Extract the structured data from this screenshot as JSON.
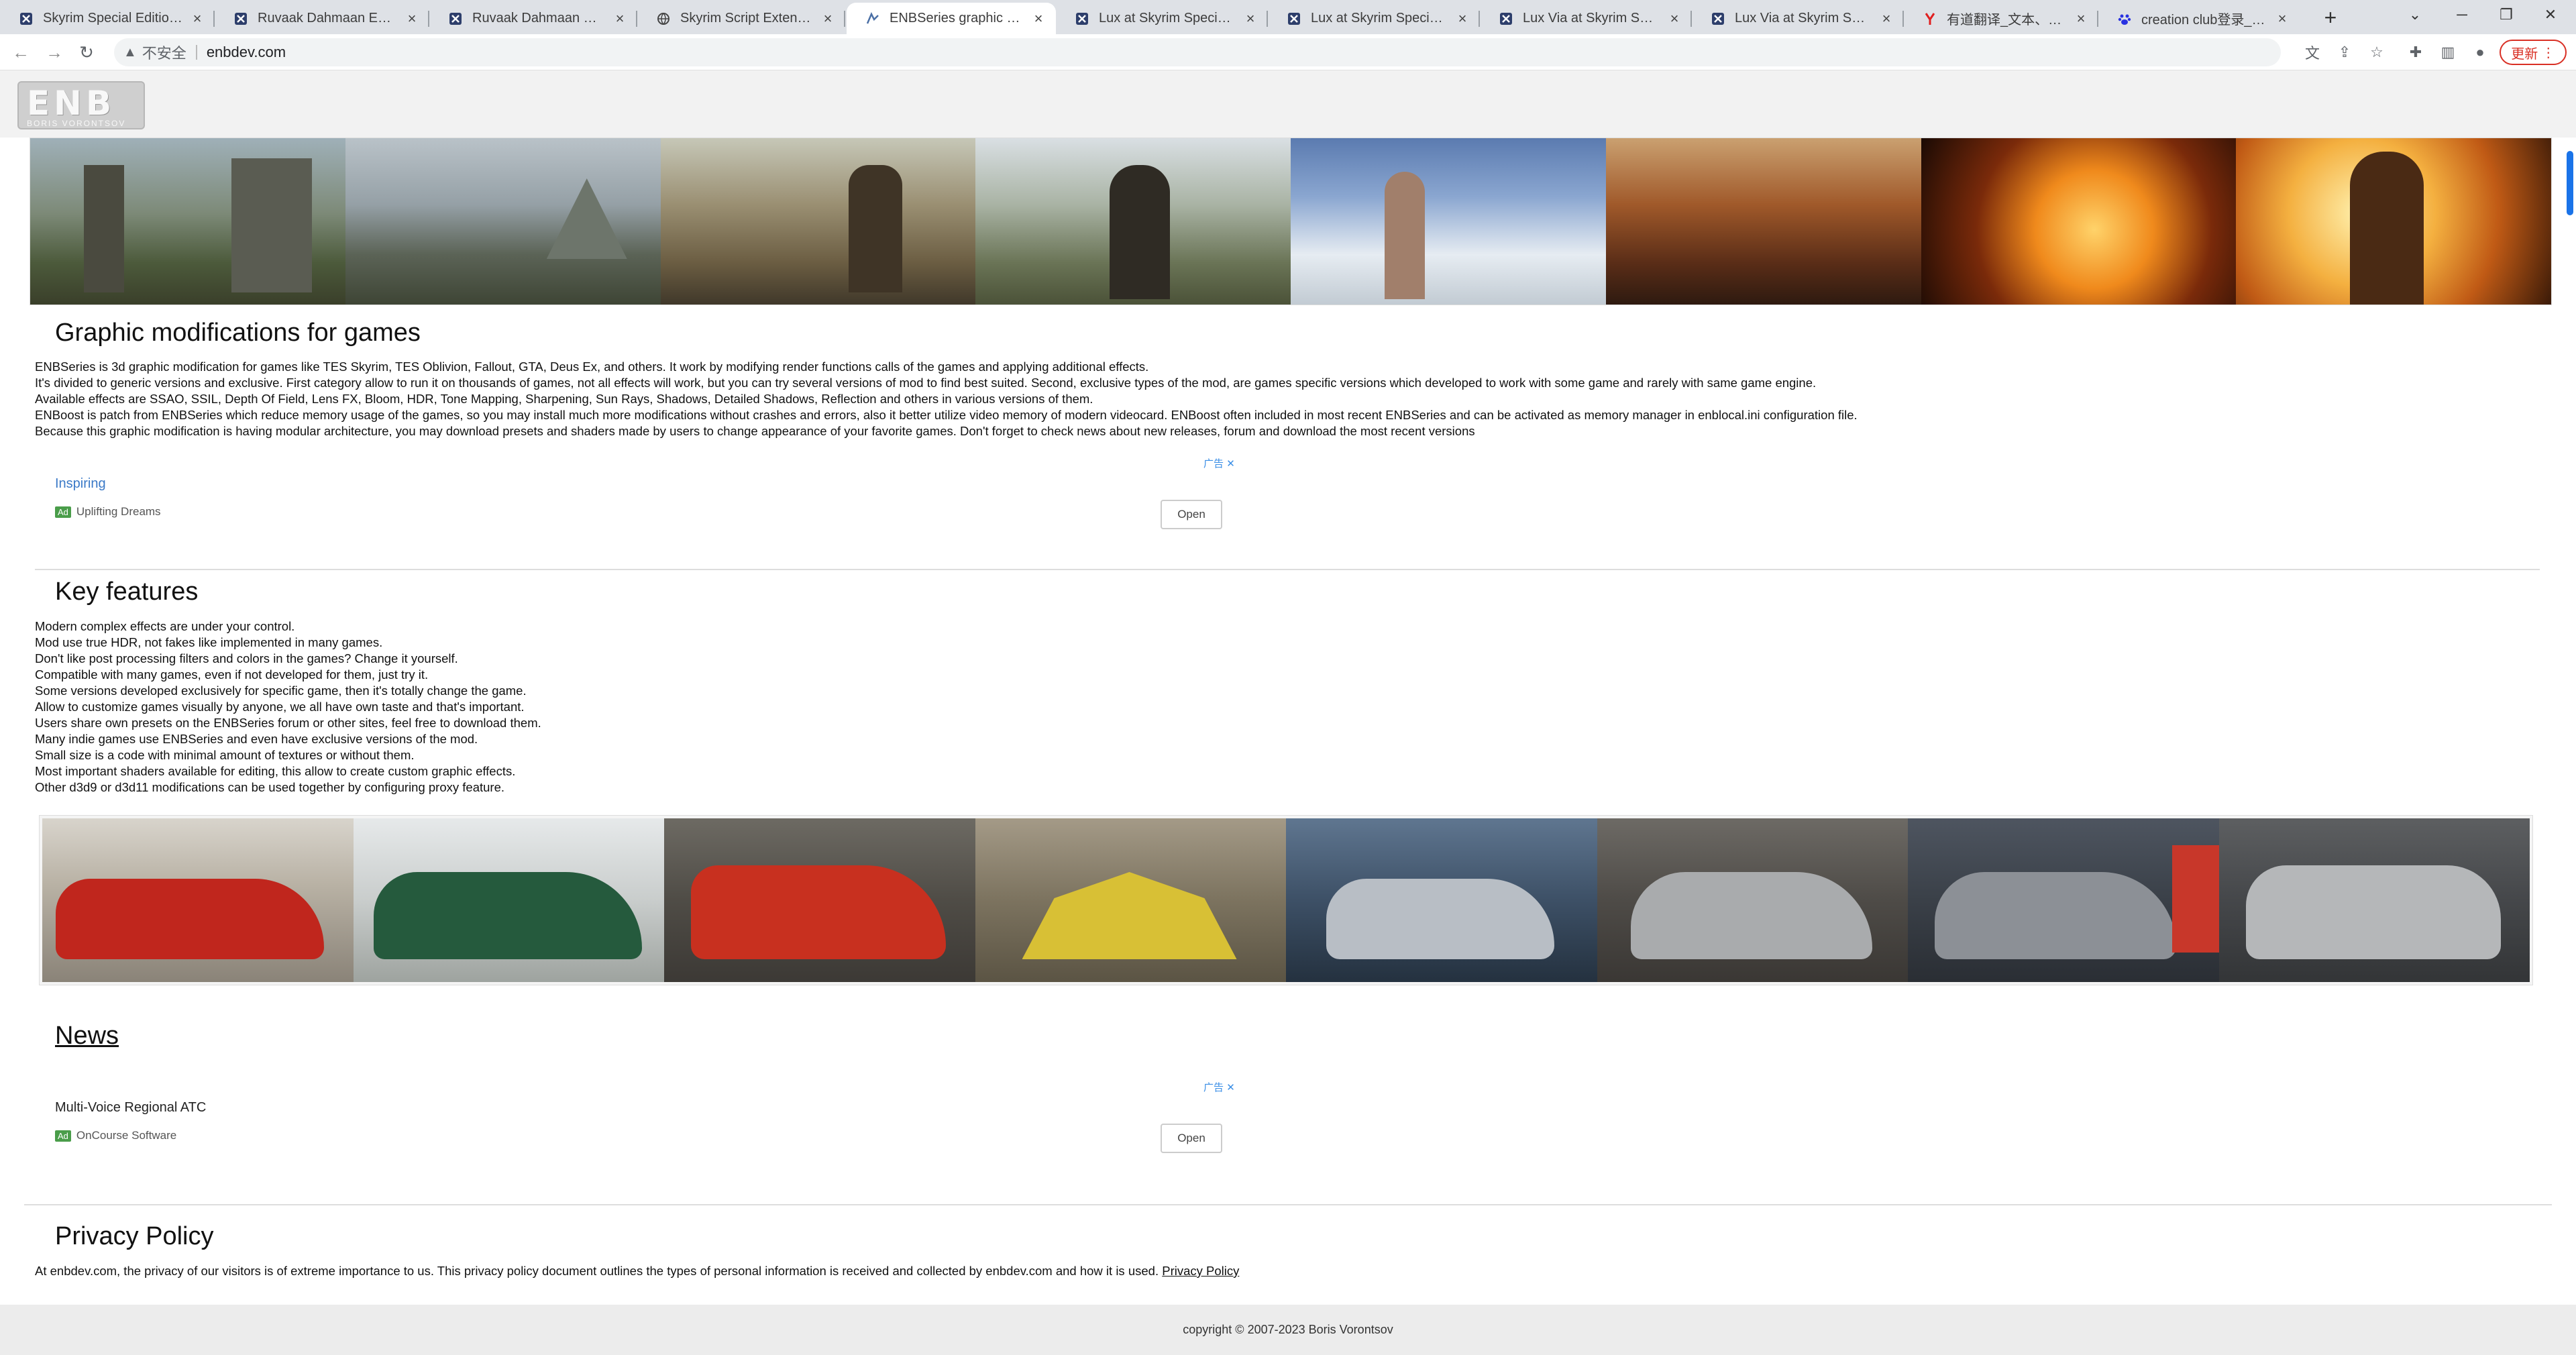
{
  "browser": {
    "tabs": [
      {
        "title": "Skyrim Special Edition Nexus",
        "icon": "nexus-icon",
        "active": false
      },
      {
        "title": "Ruvaak Dahmaan ENB SE",
        "icon": "nexus-icon",
        "active": false
      },
      {
        "title": "Ruvaak Dahmaan ENB SE",
        "icon": "nexus-icon",
        "active": false
      },
      {
        "title": "Skyrim Script Extender (SKSE)",
        "icon": "globe-icon",
        "active": false
      },
      {
        "title": "ENBSeries graphic modification",
        "icon": "enb-icon",
        "active": true
      },
      {
        "title": "Lux at Skyrim Special Edition",
        "icon": "nexus-icon",
        "active": false
      },
      {
        "title": "Lux at Skyrim Special Edition",
        "icon": "nexus-icon",
        "active": false
      },
      {
        "title": "Lux Via at Skyrim Special Edition",
        "icon": "nexus-icon",
        "active": false
      },
      {
        "title": "Lux Via at Skyrim Special Edition",
        "icon": "nexus-icon",
        "active": false
      },
      {
        "title": "有道翻译_文本、文档、网页",
        "icon": "youdao-icon",
        "active": false
      },
      {
        "title": "creation club登录_百度搜索",
        "icon": "baidu-icon",
        "active": false
      }
    ],
    "new_tab": "+",
    "not_secure_label": "不安全",
    "url": "enbdev.com",
    "update_label": "更新"
  },
  "site": {
    "logo_text": "ENB",
    "logo_subtext": "BORIS VORONTSOV"
  },
  "intro": {
    "heading": "Graphic modifications for games",
    "lines": [
      "ENBSeries is 3d graphic modification for games like TES Skyrim, TES Oblivion, Fallout, GTA, Deus Ex, and others. It work by modifying render functions calls of the games and applying additional effects.",
      "It's divided to generic versions and exclusive. First category allow to run it on thousands of games, not all effects will work, but you can try several versions of mod to find best suited. Second, exclusive types of the mod, are games specific versions which developed to work with some game and rarely with same game engine.",
      "Available effects are SSAO, SSIL, Depth Of Field, Lens FX, Bloom, HDR, Tone Mapping, Sharpening, Sun Rays, Shadows, Detailed Shadows, Reflection and others in various versions of them.",
      "ENBoost is patch from ENBSeries which reduce memory usage of the games, so you may install much more modifications without crashes and errors, also it better utilize video memory of modern videocard. ENBoost often included in most recent ENBSeries and can be activated as memory manager in enblocal.ini configuration file.",
      "Because this graphic modification is having modular architecture, you may download presets and shaders made by users to change appearance of your favorite games. Don't forget to check news about new releases, forum and download the most recent versions"
    ]
  },
  "ad1": {
    "title": "Inspiring",
    "ad_tag": "Ad",
    "sponsor": "Uplifting Dreams",
    "choice": "广告",
    "open_label": "Open"
  },
  "features": {
    "heading": "Key features",
    "lines": [
      "Modern complex effects are under your control.",
      "Mod use true HDR, not fakes like implemented in many games.",
      "Don't like post processing filters and colors in the games? Change it yourself.",
      "Compatible with many games, even if not developed for them, just try it.",
      "Some versions developed exclusively for specific game, then it's totally change the game.",
      "Allow to customize games visually by anyone, we all have own taste and that's important.",
      "Users share own presets on the ENBSeries forum or other sites, feel free to download them.",
      "Many indie games use ENBSeries and even have exclusive versions of the mod.",
      "Small size is a code with minimal amount of textures or without them.",
      "Most important shaders available for editing, this allow to create custom graphic effects.",
      "Other d3d9 or d3d11 modifications can be used together by configuring proxy feature."
    ]
  },
  "news": {
    "heading": "News"
  },
  "ad2": {
    "title": "Multi-Voice Regional ATC",
    "ad_tag": "Ad",
    "sponsor": "OnCourse Software",
    "choice": "广告",
    "open_label": "Open"
  },
  "privacy": {
    "heading": "Privacy Policy",
    "text": "At enbdev.com, the privacy of our visitors is of extreme importance to us. This privacy policy document outlines the types of personal information is received and collected by enbdev.com and how it is used.",
    "link": "Privacy Policy"
  },
  "footer": {
    "copyright": "copyright © 2007-2023 Boris Vorontsov"
  },
  "colors": {
    "accent": "#1a73e8",
    "ad_link": "#3a79c7",
    "update": "#d93025"
  }
}
